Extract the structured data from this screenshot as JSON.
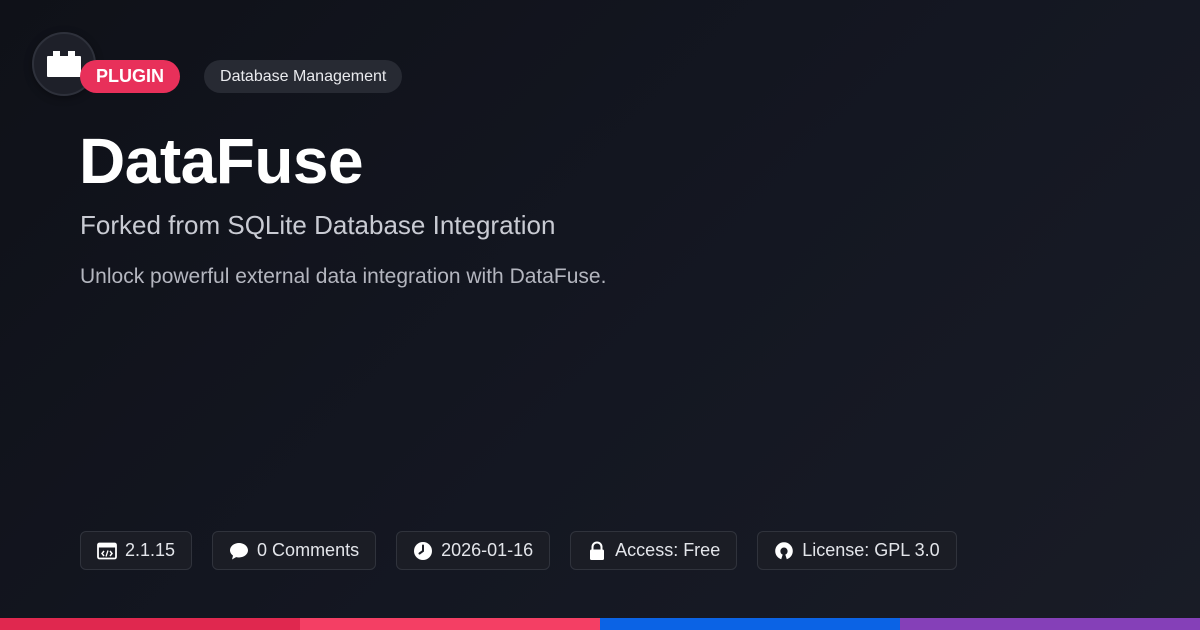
{
  "header": {
    "logo_icon": "plugin-block-icon",
    "type_badge": "PLUGIN",
    "category_badge": "Database Management"
  },
  "main": {
    "title": "DataFuse",
    "subtitle": "Forked from SQLite Database Integration",
    "description": "Unlock powerful external data integration with DataFuse."
  },
  "meta": {
    "version": "2.1.15",
    "comments": "0 Comments",
    "date": "2026-01-16",
    "access": "Access: Free",
    "license": "License: GPL 3.0"
  },
  "colors": {
    "accent": "#e8305a",
    "bar": [
      "#e0284f",
      "#f43f64",
      "#0b63e5",
      "#8540b8"
    ]
  }
}
